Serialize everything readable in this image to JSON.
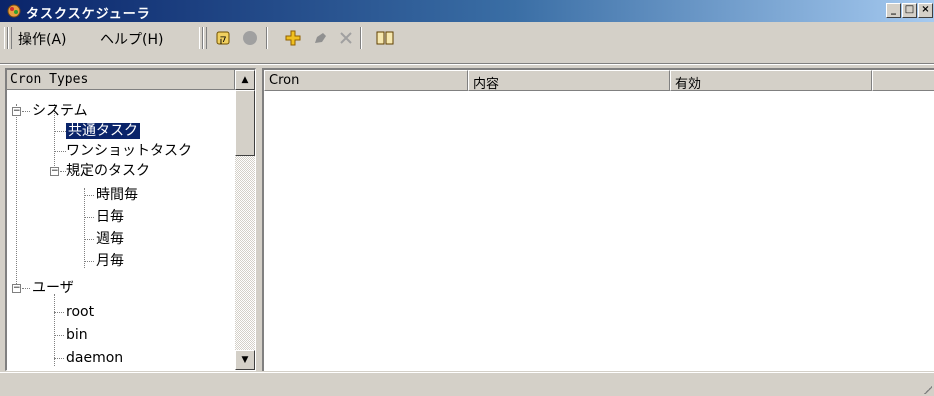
{
  "window": {
    "title": "タスクスケジューラ"
  },
  "menubar": {
    "items": [
      {
        "label": "操作(A)"
      },
      {
        "label": "ヘルプ(H)"
      }
    ]
  },
  "toolbar": {
    "icons": [
      "refresh-icon",
      "stop-icon",
      "add-icon",
      "edit-icon",
      "delete-icon",
      "book-icon"
    ]
  },
  "tree": {
    "header": "Cron Types",
    "nodes": [
      {
        "label": "システム"
      },
      {
        "label": "共通タスク",
        "selected": true
      },
      {
        "label": "ワンショットタスク"
      },
      {
        "label": "規定のタスク"
      },
      {
        "label": "時間毎"
      },
      {
        "label": "日毎"
      },
      {
        "label": "週毎"
      },
      {
        "label": "月毎"
      },
      {
        "label": "ユーザ"
      },
      {
        "label": "root"
      },
      {
        "label": "bin"
      },
      {
        "label": "daemon"
      }
    ]
  },
  "list": {
    "columns": [
      {
        "label": "Cron"
      },
      {
        "label": "内容"
      },
      {
        "label": "有効"
      }
    ],
    "rows": []
  },
  "colors": {
    "titlebar_start": "#0a246a",
    "selection": "#0a246a",
    "chrome": "#d4d0c8"
  }
}
